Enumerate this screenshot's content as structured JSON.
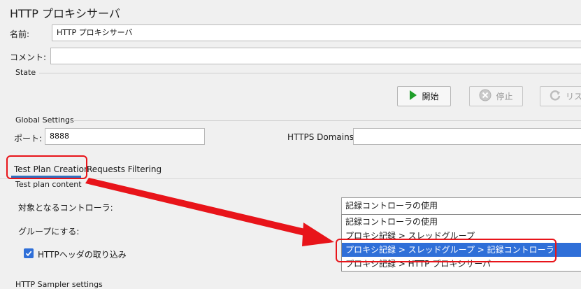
{
  "window": {
    "title": "HTTP プロキシサーバ"
  },
  "name_field": {
    "label": "名前:",
    "value": "HTTP プロキシサーバ"
  },
  "comment_field": {
    "label": "コメント:",
    "value": ""
  },
  "state": {
    "title": "State",
    "start_label": "開始",
    "stop_label": "停止",
    "restart_label": "リス"
  },
  "global_settings": {
    "title": "Global Settings",
    "port_label": "ポート:",
    "port_value": "8888",
    "https_label": "HTTPS Domains:",
    "https_value": ""
  },
  "tabs": [
    {
      "label": "Test Plan Creation",
      "active": true
    },
    {
      "label": "Requests Filtering",
      "active": false
    }
  ],
  "test_plan": {
    "title": "Test plan content",
    "controller_label": "対象となるコントローラ:",
    "controller_selected": "記録コントローラの使用",
    "group_label": "グループにする:",
    "capture_headers_label": "HTTPヘッダの取り込み",
    "capture_headers_checked": true,
    "options": [
      "記録コントローラの使用",
      "プロキシ記録 > スレッドグループ",
      "プロキシ記録 > スレッドグループ > 記録コントローラ",
      "プロキシ記録 > HTTP プロキシサーバ"
    ],
    "highlighted_option_index": 2
  },
  "footer": {
    "partial_title": "HTTP Sampler settings"
  },
  "colors": {
    "accent": "#2f6fd8",
    "annotation": "#e8141a",
    "start_green": "#1f9e2a"
  }
}
